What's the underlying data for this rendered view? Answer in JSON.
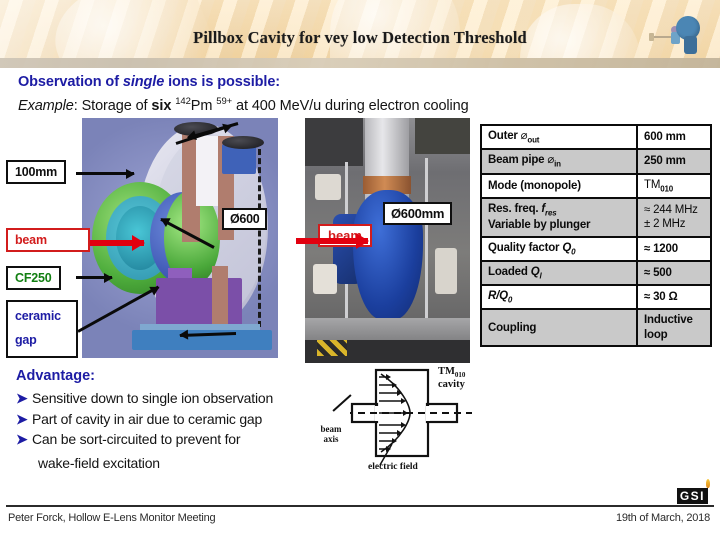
{
  "header": {
    "title": "Pillbox Cavity for vey low Detection Threshold",
    "logo_icon": "gsi-detector-icon"
  },
  "lead": {
    "line1_pre": "Observation of ",
    "line1_em": "single",
    "line1_post": " ions is possible:",
    "line2_em": "Example",
    "line2_a": ": Storage of ",
    "line2_b": "six",
    "line2_sup1": "142",
    "line2_c": "Pm ",
    "line2_sup2": "59+",
    "line2_d": " at 400 MeV/u  during electron cooling"
  },
  "cad": {
    "label_100mm": "100mm",
    "label_beam": "beam",
    "label_cf250": "CF250",
    "label_ceramic": "ceramic",
    "label_gap": "gap",
    "label_d600": "Ø600"
  },
  "photo": {
    "label_d600mm": "Ø600mm",
    "label_beam": "beam"
  },
  "spec_table": {
    "rows": [
      {
        "key": "Outer ⌀out",
        "value": "600 mm"
      },
      {
        "key": "Beam pipe ⌀in",
        "value": "250 mm"
      },
      {
        "key": "Mode (monopole)",
        "value": "TM010"
      },
      {
        "key": "Res. freq. fres Variable by plunger",
        "value": "≈ 244 MHz ± 2 MHz"
      },
      {
        "key": "Quality factor Q0",
        "value": "≈ 1200"
      },
      {
        "key": "Loaded Ql",
        "value": "≈   500"
      },
      {
        "key": "R/Q0",
        "value": "≈ 30 Ω"
      },
      {
        "key": "Coupling",
        "value": "Inductive loop"
      }
    ],
    "r1k_a": "Outer ",
    "r1k_sym": "⌀",
    "r1k_sub": "out",
    "r1v": "600 mm",
    "r2k_a": "Beam pipe ",
    "r2k_sym": "⌀",
    "r2k_sub": "in",
    "r2v": "250 mm",
    "r3k": "Mode (monopole)",
    "r3v_a": "TM",
    "r3v_sub": "010",
    "r4k_a": "Res. freq. ",
    "r4k_it": "f",
    "r4k_sub": "res",
    "r4k_b": "Variable by plunger",
    "r4v_a": "≈ 244 MHz",
    "r4v_b": "± 2 MHz",
    "r5k_a": "Quality factor ",
    "r5k_it": "Q",
    "r5k_sub": "0",
    "r5v": "≈ 1200",
    "r6k_a": "Loaded ",
    "r6k_it": "Q",
    "r6k_sub": "l",
    "r6v": "≈   500",
    "r7k_a": "R/Q",
    "r7k_sub": "0",
    "r7v": "≈ 30 Ω",
    "r8k": "Coupling",
    "r8v_a": "Inductive",
    "r8v_b": "loop"
  },
  "advantage": {
    "heading": "Advantage:",
    "bullet": "➤",
    "items": [
      "Sensitive down to single ion observation",
      "Part of cavity in air due to ceramic gap",
      "Can be sort-circuited to prevent for"
    ],
    "continuation": "wake-field excitation"
  },
  "cavity_diagram": {
    "label_tm_a": "TM",
    "label_tm_sub": "010",
    "label_cavity": "cavity",
    "label_electric_field": "electric field",
    "label_beam": "beam",
    "label_axis": "axis"
  },
  "footer": {
    "left": "Peter Forck, Hollow E-Lens Monitor Meeting",
    "right": "19th of March, 2018",
    "logo": "GSI"
  },
  "colors": {
    "title": "#1b1b1b",
    "accent_blue": "#1d1ca4",
    "beam_red": "#d21c1c",
    "cf_green": "#127f12",
    "table_alt": "#c9c9c9"
  }
}
